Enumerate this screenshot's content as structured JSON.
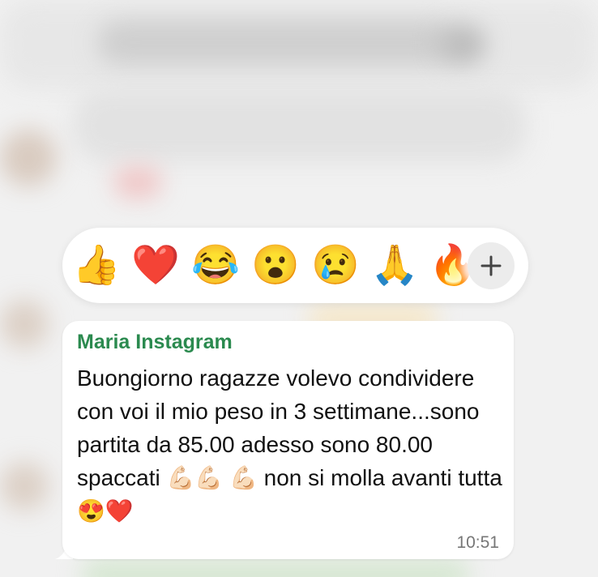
{
  "reactions": {
    "items": [
      {
        "emoji": "👍",
        "name": "thumbs-up"
      },
      {
        "emoji": "❤️",
        "name": "red-heart"
      },
      {
        "emoji": "😂",
        "name": "tears-of-joy"
      },
      {
        "emoji": "😮",
        "name": "open-mouth"
      },
      {
        "emoji": "😢",
        "name": "crying"
      },
      {
        "emoji": "🙏",
        "name": "folded-hands"
      },
      {
        "emoji": "🔥",
        "name": "fire"
      }
    ],
    "add_label": "+"
  },
  "message": {
    "sender": "Maria Instagram",
    "text": "Buongiorno ragazze volevo condividere con voi il mio peso in 3 settimane...sono partita da 85.00 adesso sono 80.00 spaccati 💪🏻💪🏻 💪🏻 non si molla avanti tutta 😍❤️",
    "time": "10:51"
  },
  "colors": {
    "sender": "#2b8a4f",
    "bubble": "#ffffff",
    "background": "#f1f1f1"
  }
}
